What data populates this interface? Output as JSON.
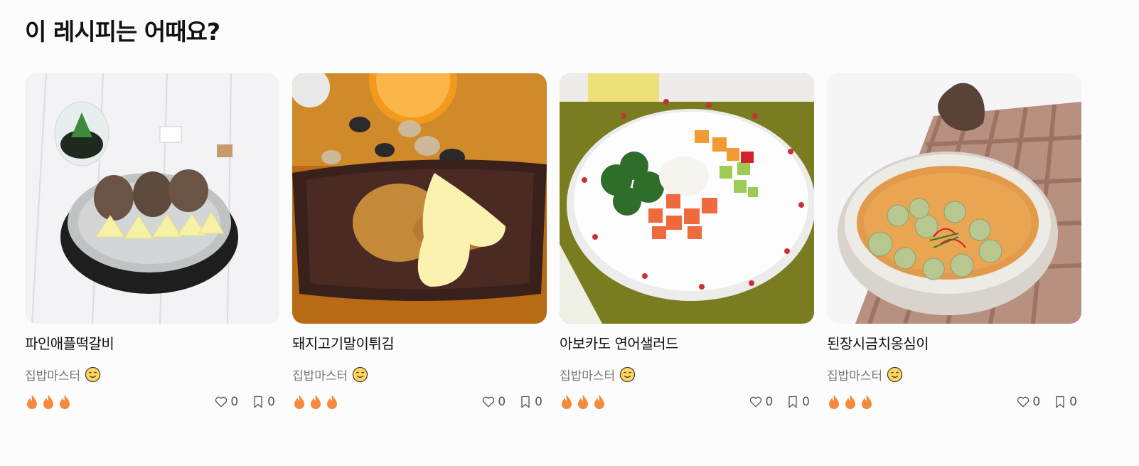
{
  "section": {
    "title": "이 레시피는 어때요?"
  },
  "cards": [
    {
      "title": "파인애플떡갈비",
      "author": "집밥마스터",
      "difficulty": 3,
      "likes": "0",
      "bookmarks": "0"
    },
    {
      "title": "돼지고기말이튀김",
      "author": "집밥마스터",
      "difficulty": 3,
      "likes": "0",
      "bookmarks": "0"
    },
    {
      "title": "아보카도 연어샐러드",
      "author": "집밥마스터",
      "difficulty": 3,
      "likes": "0",
      "bookmarks": "0"
    },
    {
      "title": "된장시금치옹심이",
      "author": "집밥마스터",
      "difficulty": 3,
      "likes": "0",
      "bookmarks": "0"
    }
  ],
  "icons": {
    "difficulty": "flame-icon",
    "like": "heart-icon",
    "bookmark": "bookmark-icon",
    "author_badge": "smiling-face-icon"
  },
  "colors": {
    "flame": "#f58a3c",
    "muted_text": "#777777",
    "title_text": "#111111"
  }
}
